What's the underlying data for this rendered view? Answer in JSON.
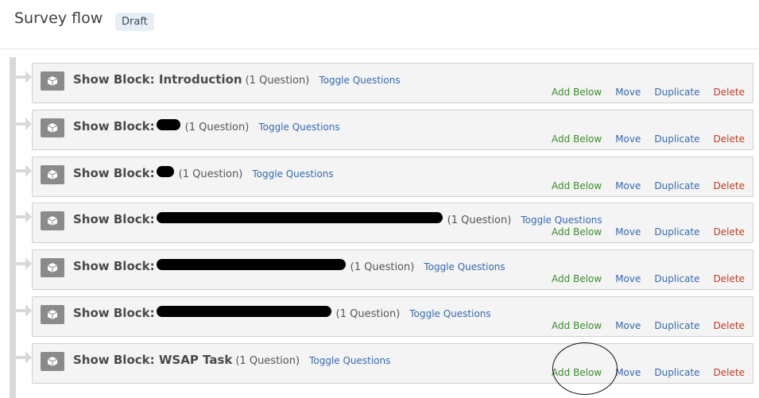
{
  "header": {
    "title": "Survey flow",
    "status": "Draft"
  },
  "blocks": [
    {
      "label": "Show Block:",
      "name": "Introduction",
      "count": "(1 Question)"
    },
    {
      "label": "Show Block:",
      "name": "",
      "count": "(1 Question)"
    },
    {
      "label": "Show Block:",
      "name": "",
      "count": "(1 Question)"
    },
    {
      "label": "Show Block:",
      "name": "",
      "count": "(1 Question)"
    },
    {
      "label": "Show Block:",
      "name": "",
      "count": "(1 Question)"
    },
    {
      "label": "Show Block:",
      "name": "",
      "count": "(1 Question)"
    },
    {
      "label": "Show Block:",
      "name": "WSAP Task",
      "count": "(1 Question)"
    }
  ],
  "labels": {
    "toggle": "Toggle Questions",
    "add_below": "Add Below",
    "move": "Move",
    "duplicate": "Duplicate",
    "delete": "Delete"
  },
  "icons": {
    "block": "cube-icon",
    "connector": "arrow-right-icon"
  },
  "colors": {
    "add": "#3e8b2f",
    "link": "#3569b3",
    "delete": "#c23b22"
  }
}
